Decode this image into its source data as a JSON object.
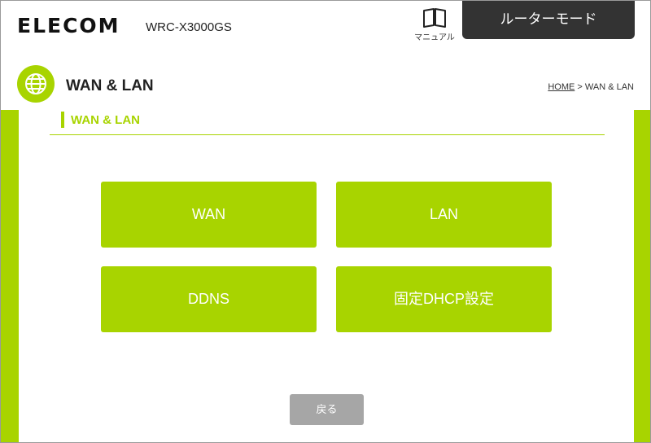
{
  "header": {
    "logo": "ELECOM",
    "model": "WRC-X3000GS",
    "manual_label": "マニュアル",
    "manual_icon": "book-icon",
    "mode_label": "ルーターモード"
  },
  "title_bar": {
    "icon": "globe-icon",
    "title": "WAN & LAN",
    "breadcrumb_home": "HOME",
    "breadcrumb_separator": ">",
    "breadcrumb_current": "WAN & LAN"
  },
  "section": {
    "title": "WAN & LAN"
  },
  "tiles": [
    {
      "label": "WAN"
    },
    {
      "label": "LAN"
    },
    {
      "label": "DDNS"
    },
    {
      "label": "固定DHCP設定"
    }
  ],
  "back_label": "戻る",
  "colors": {
    "accent": "#a8d400",
    "dark": "#333333",
    "button_gray": "#a6a6a6"
  }
}
